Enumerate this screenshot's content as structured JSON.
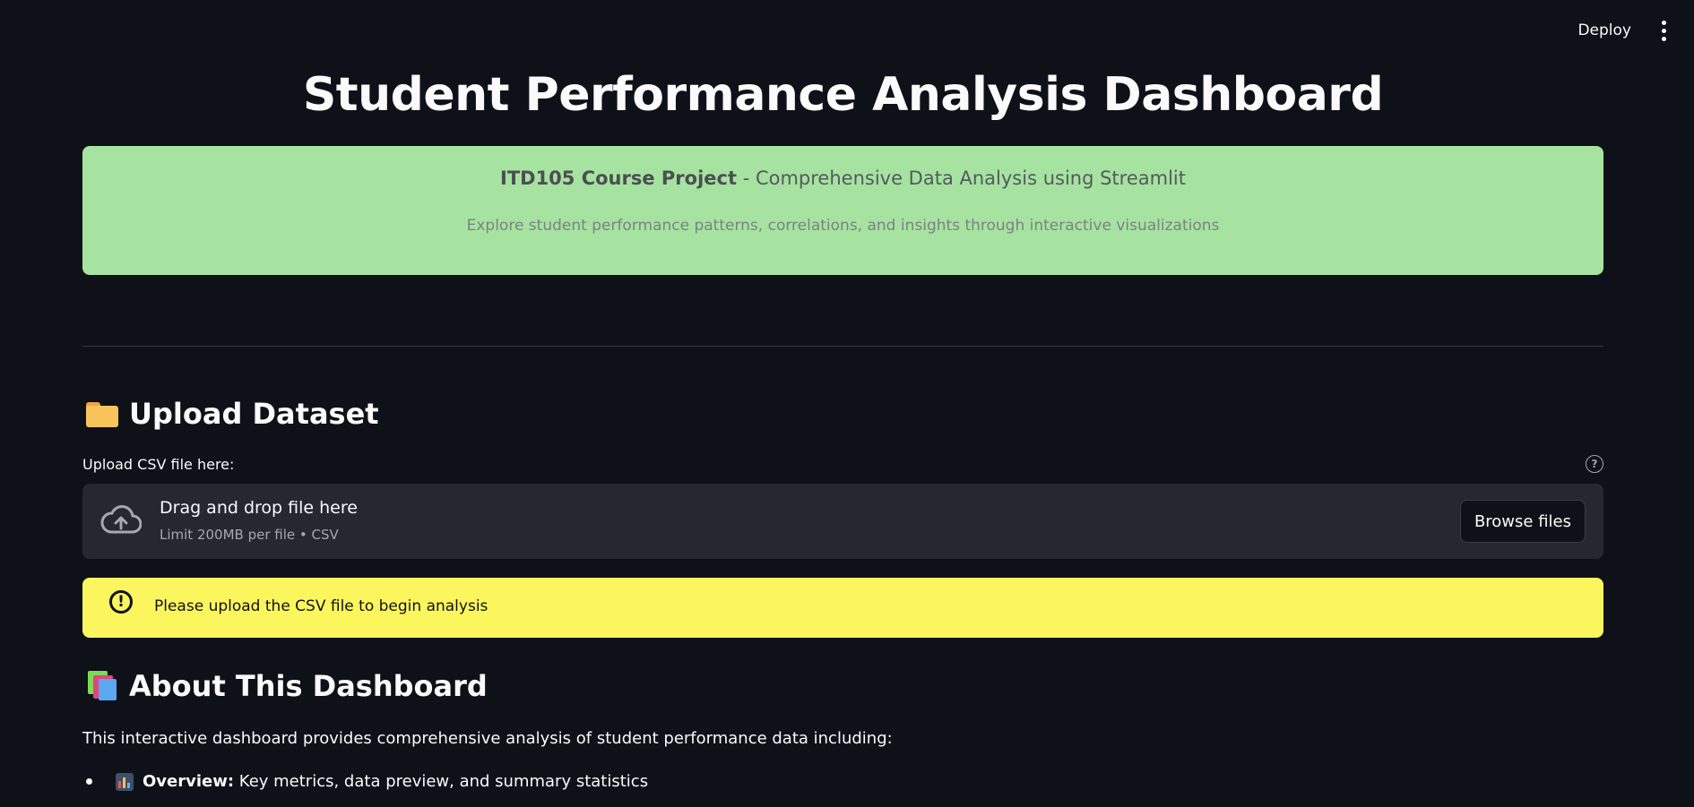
{
  "topbar": {
    "deploy_label": "Deploy",
    "menu_icon": "kebab-menu-icon"
  },
  "page": {
    "title": "Student Performance Analysis Dashboard"
  },
  "banner": {
    "course_bold": "ITD105 Course Project",
    "course_rest": " - Comprehensive Data Analysis using Streamlit",
    "subtitle": "Explore student performance patterns, correlations, and insights through interactive visualizations",
    "background": "#a6e3a1"
  },
  "upload_section": {
    "heading": "Upload Dataset",
    "heading_icon": "folder-icon",
    "field_label": "Upload CSV file here:",
    "dropzone_title": "Drag and drop file here",
    "dropzone_hint": "Limit 200MB per file • CSV",
    "browse_label": "Browse files"
  },
  "warning": {
    "icon": "exclamation-circle-icon",
    "text": "Please upload the CSV file to begin analysis",
    "background": "#fcf65e"
  },
  "about_section": {
    "heading": "About This Dashboard",
    "heading_icon": "books-icon",
    "intro": "This interactive dashboard provides comprehensive analysis of student performance data including:",
    "items": [
      {
        "icon": "bar-chart-icon",
        "label": "Overview:",
        "text": " Key metrics, data preview, and summary statistics"
      }
    ]
  },
  "colors": {
    "app_background": "#0e1117",
    "dropzone_background": "#262730"
  }
}
